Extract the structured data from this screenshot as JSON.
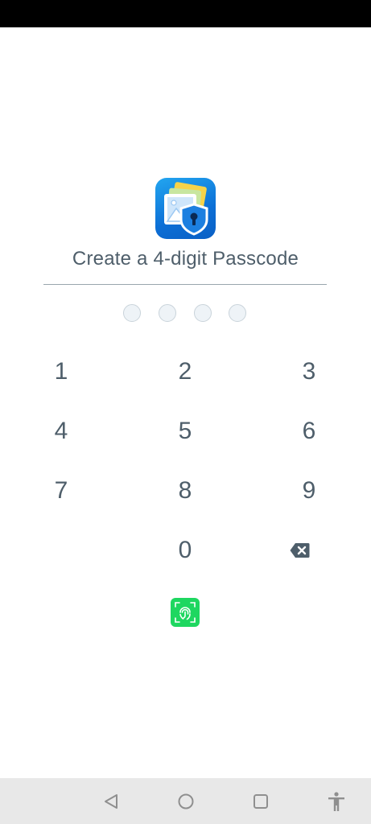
{
  "title": "Create a 4-digit Passcode",
  "passcode": {
    "length": 4,
    "entered": 0
  },
  "keypad": {
    "k1": "1",
    "k2": "2",
    "k3": "3",
    "k4": "4",
    "k5": "5",
    "k6": "6",
    "k7": "7",
    "k8": "8",
    "k9": "9",
    "k0": "0"
  },
  "icons": {
    "app": "photo-vault-shield-icon",
    "backspace": "backspace-icon",
    "fingerprint": "fingerprint-icon",
    "nav_back": "back-triangle-icon",
    "nav_home": "home-circle-icon",
    "nav_recents": "recents-square-icon",
    "nav_accessibility": "accessibility-icon"
  },
  "colors": {
    "fingerprint_accent": "#1ed760",
    "app_icon_blue": "#1a8ae6",
    "text": "#4e5e6a"
  }
}
